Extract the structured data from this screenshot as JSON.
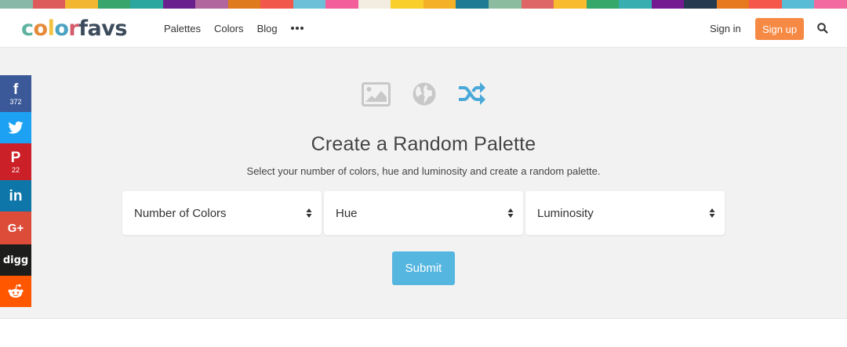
{
  "color_strip": [
    "#88b9a8",
    "#de5b5b",
    "#f2b630",
    "#38a56c",
    "#2ba7a0",
    "#6a1f8f",
    "#b1669d",
    "#e07a1f",
    "#f2574b",
    "#6cc1d8",
    "#f25f9a",
    "#f3ece1",
    "#f9cf2c",
    "#f4b128",
    "#1e7b93",
    "#8cbc9f",
    "#de6666",
    "#f8bb2d",
    "#35a86a",
    "#38aeb1",
    "#741b92",
    "#263a4f",
    "#e77a1f",
    "#f5574a",
    "#58bcd6",
    "#f26a9f"
  ],
  "brand": {
    "logo_parts": [
      "c",
      "o",
      "l",
      "o",
      "r",
      "f",
      "a",
      "v",
      "s"
    ]
  },
  "nav": {
    "items": [
      "Palettes",
      "Colors",
      "Blog"
    ],
    "more_icon": "ellipsis-icon"
  },
  "header_right": {
    "signin_label": "Sign in",
    "signup_label": "Sign up",
    "search_icon": "search-icon"
  },
  "social": {
    "facebook_count": "372",
    "pinterest_count": "22",
    "googleplus_label": "G+",
    "digg_label": "digg"
  },
  "mode_icons": [
    "image-icon",
    "globe-icon",
    "shuffle-icon"
  ],
  "main": {
    "title": "Create a Random Palette",
    "subtitle": "Select your number of colors, hue and luminosity and create a random palette.",
    "selects": [
      "Number of Colors",
      "Hue",
      "Luminosity"
    ],
    "submit_label": "Submit"
  },
  "colors": {
    "accent": "#55b6e0",
    "signup": "#f68a45"
  }
}
